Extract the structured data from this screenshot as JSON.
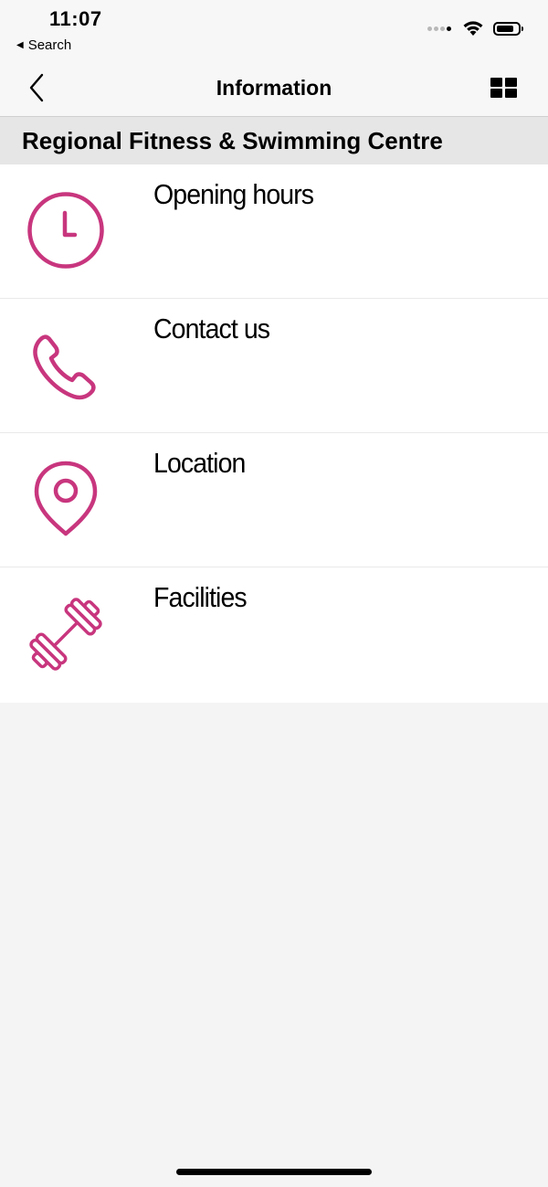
{
  "status_bar": {
    "time": "11:07",
    "back_to_app": "Search",
    "icons": [
      "cellular-signal-icon",
      "wifi-icon",
      "battery-icon"
    ]
  },
  "nav_bar": {
    "title": "Information",
    "back_icon": "chevron-left-icon",
    "grid_icon": "grid-menu-icon"
  },
  "section": {
    "title": "Regional Fitness & Swimming Centre"
  },
  "items": [
    {
      "label": "Opening hours",
      "icon": "clock-icon"
    },
    {
      "label": "Contact us",
      "icon": "phone-icon"
    },
    {
      "label": "Location",
      "icon": "location-pin-icon"
    },
    {
      "label": "Facilities",
      "icon": "dumbbell-icon"
    }
  ],
  "colors": {
    "accent": "#c8367e",
    "background": "#f4f4f4",
    "header_band": "#e6e6e6"
  }
}
